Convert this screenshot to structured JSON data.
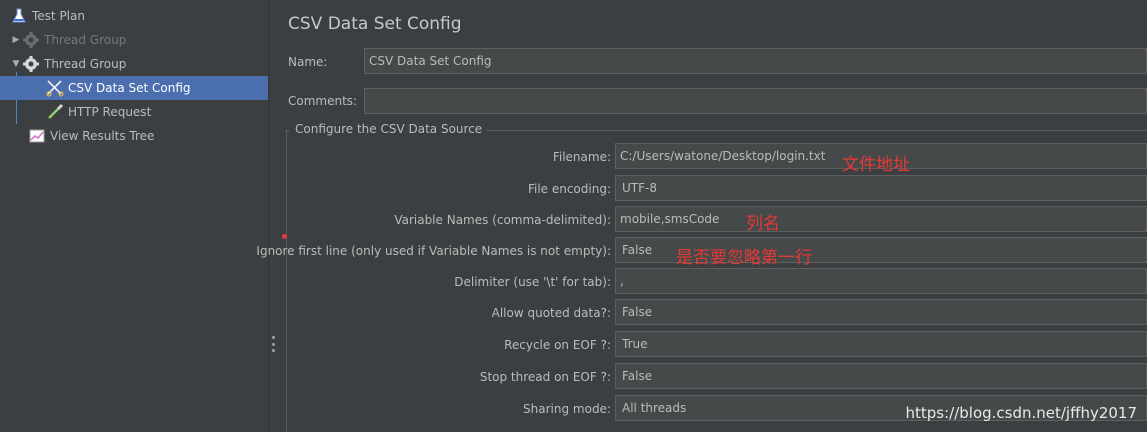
{
  "tree": {
    "items": [
      {
        "label": "Test Plan",
        "icon": "test-plan-flask-icon"
      },
      {
        "label": "Thread Group",
        "icon": "gear-icon",
        "state": "disabled"
      },
      {
        "label": "Thread Group",
        "icon": "gear-icon",
        "state": "expanded"
      },
      {
        "label": "CSV Data Set Config",
        "icon": "scissors-icon",
        "state": "selected"
      },
      {
        "label": "HTTP Request",
        "icon": "pipette-icon"
      },
      {
        "label": "View Results Tree",
        "icon": "chart-icon"
      }
    ]
  },
  "panel": {
    "title": "CSV Data Set Config",
    "name_label": "Name:",
    "name_value": "CSV Data Set Config",
    "comments_label": "Comments:",
    "comments_value": "",
    "section_title": "Configure the CSV Data Source",
    "fields": [
      {
        "label": "Filename:",
        "value": "C:/Users/watone/Desktop/login.txt"
      },
      {
        "label": "File encoding:",
        "value": "UTF-8"
      },
      {
        "label": "Variable Names (comma-delimited):",
        "value": "mobile,smsCode"
      },
      {
        "label": "Ignore first line (only used if Variable Names is not empty):",
        "value": "False"
      },
      {
        "label": "Delimiter (use '\\t' for tab):",
        "value": ","
      },
      {
        "label": "Allow quoted data?:",
        "value": "False"
      },
      {
        "label": "Recycle on EOF ?:",
        "value": "True"
      },
      {
        "label": "Stop thread on EOF ?:",
        "value": "False"
      },
      {
        "label": "Sharing mode:",
        "value": "All threads"
      }
    ]
  },
  "annotations": {
    "filename_note": "文件地址",
    "variables_note": "列名",
    "ignore_note": "是否要忽略第一行"
  },
  "watermark": "https://blog.csdn.net/jffhy2017",
  "colors": {
    "background": "#3c3f41",
    "selection": "#4b6eaf",
    "field_bg": "#45494a",
    "annotation": "#e53935"
  }
}
